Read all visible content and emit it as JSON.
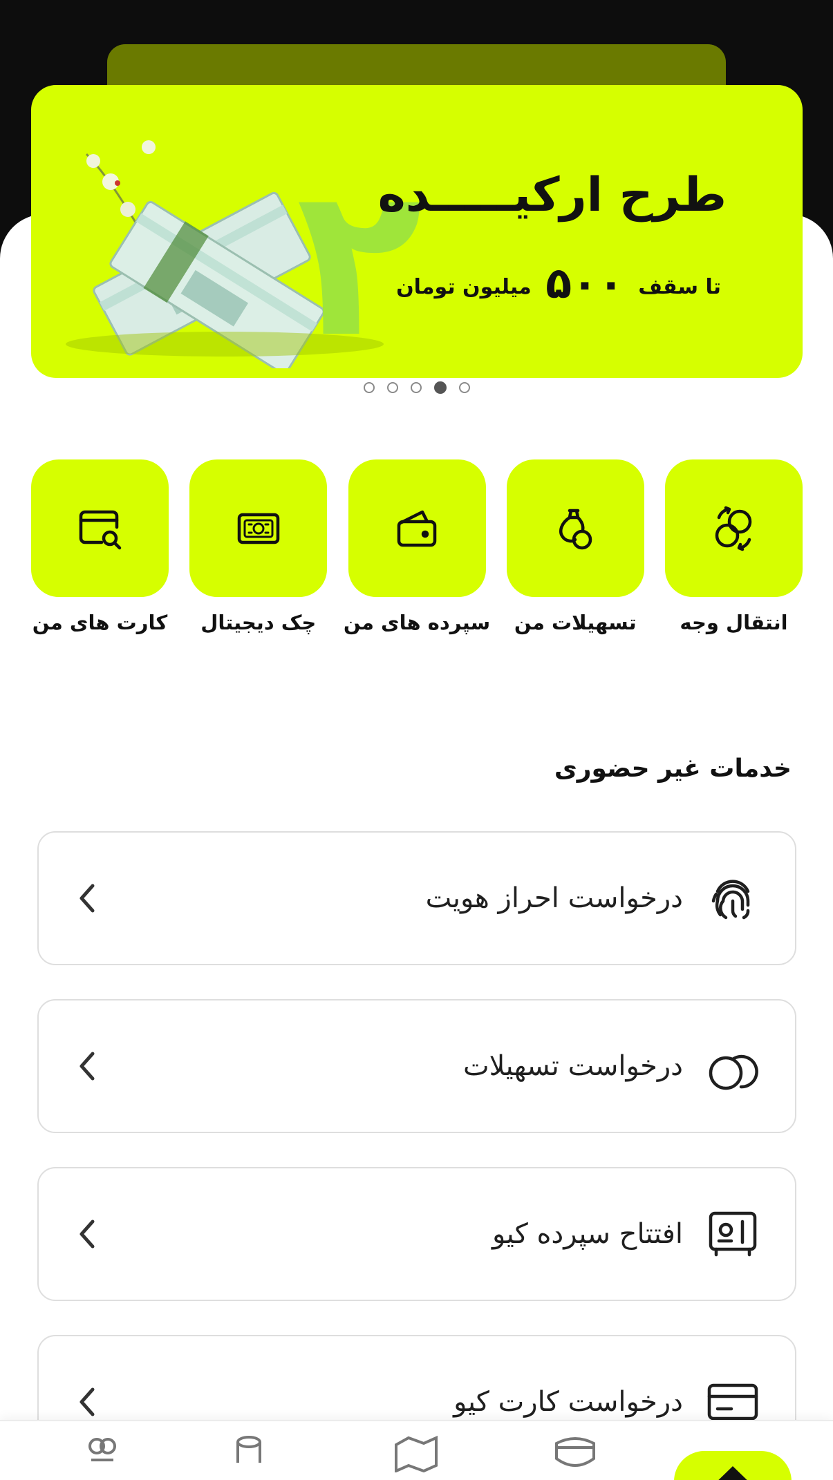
{
  "banner": {
    "title": "طرح ارکیـــــده",
    "subtitle_pre": "تا سقف",
    "subtitle_amount": "۵۰۰",
    "subtitle_post": "میلیون تومان",
    "numeral": "۲",
    "accent_color": "#d6ff00"
  },
  "carousel": {
    "count": 5,
    "active_index": 3
  },
  "quick_actions": [
    {
      "label": "انتقال وجه",
      "icon": "transfer-icon"
    },
    {
      "label": "تسهیلات من",
      "icon": "money-bag-icon"
    },
    {
      "label": "سپرده های من",
      "icon": "wallet-icon"
    },
    {
      "label": "چک دیجیتال",
      "icon": "digital-check-icon"
    },
    {
      "label": "کارت های من",
      "icon": "card-search-icon"
    }
  ],
  "services": {
    "title": "خدمات غیر حضوری",
    "items": [
      {
        "label": "درخواست احراز هویت",
        "icon": "fingerprint-icon"
      },
      {
        "label": "درخواست تسهیلات",
        "icon": "loan-rings-icon"
      },
      {
        "label": "افتتاح سپرده کیو",
        "icon": "deposit-safe-icon"
      },
      {
        "label": "درخواست کارت کیو",
        "icon": "credit-card-icon"
      }
    ]
  },
  "bottom_nav": {
    "items": [
      "home-icon",
      "shield-icon",
      "map-icon",
      "coins-icon",
      "services-icon"
    ],
    "active": "home-icon"
  }
}
